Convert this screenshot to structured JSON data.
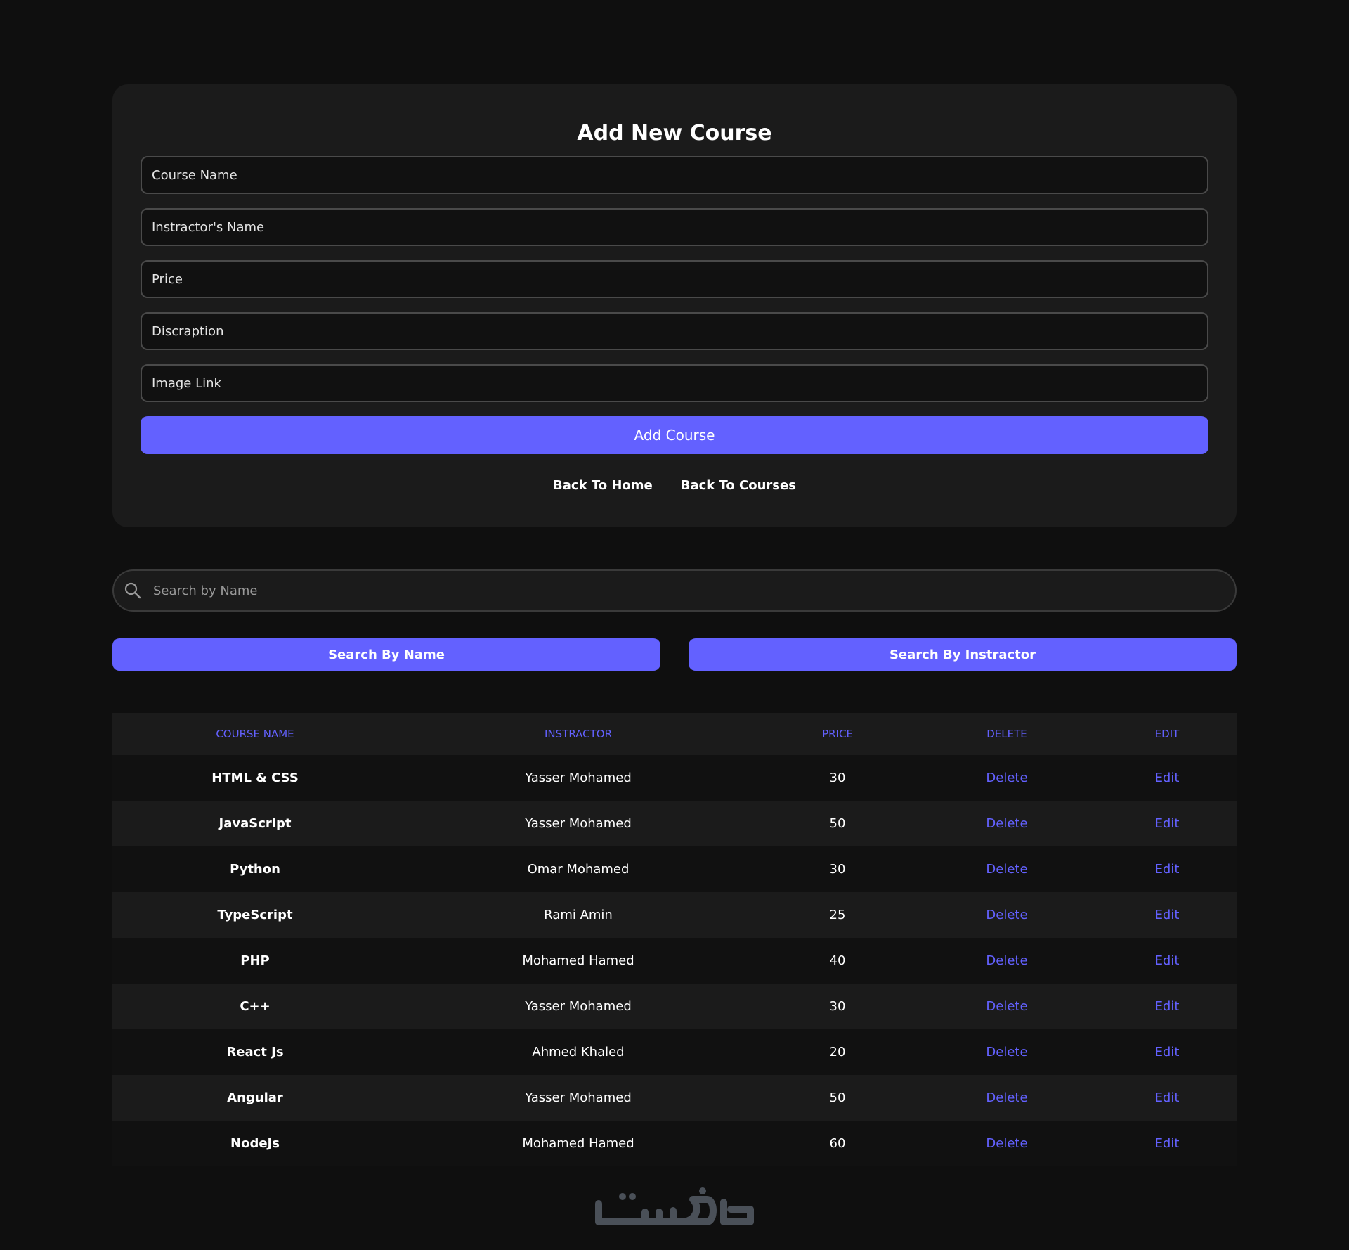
{
  "form": {
    "title": "Add New Course",
    "fields": [
      {
        "placeholder": "Course Name",
        "value": ""
      },
      {
        "placeholder": "Instractor's Name",
        "value": ""
      },
      {
        "placeholder": "Price",
        "value": ""
      },
      {
        "placeholder": "Discraption",
        "value": ""
      },
      {
        "placeholder": "Image Link",
        "value": ""
      }
    ],
    "submit_label": "Add Course",
    "links": [
      "Back To Home",
      "Back To Courses"
    ]
  },
  "search": {
    "placeholder": "Search by Name",
    "value": "",
    "by_name_label": "Search By Name",
    "by_instructor_label": "Search By Instractor"
  },
  "table": {
    "headers": [
      "Course Name",
      "Instractor",
      "Price",
      "Delete",
      "Edit"
    ],
    "rows": [
      {
        "name": "HTML & CSS",
        "instructor": "Yasser Mohamed",
        "price": "30",
        "delete": "Delete",
        "edit": "Edit"
      },
      {
        "name": "JavaScript",
        "instructor": "Yasser Mohamed",
        "price": "50",
        "delete": "Delete",
        "edit": "Edit"
      },
      {
        "name": "Python",
        "instructor": "Omar Mohamed",
        "price": "30",
        "delete": "Delete",
        "edit": "Edit"
      },
      {
        "name": "TypeScript",
        "instructor": "Rami Amin",
        "price": "25",
        "delete": "Delete",
        "edit": "Edit"
      },
      {
        "name": "PHP",
        "instructor": "Mohamed Hamed",
        "price": "40",
        "delete": "Delete",
        "edit": "Edit"
      },
      {
        "name": "C++",
        "instructor": "Yasser Mohamed",
        "price": "30",
        "delete": "Delete",
        "edit": "Edit"
      },
      {
        "name": "React Js",
        "instructor": "Ahmed Khaled",
        "price": "20",
        "delete": "Delete",
        "edit": "Edit"
      },
      {
        "name": "Angular",
        "instructor": "Yasser Mohamed",
        "price": "50",
        "delete": "Delete",
        "edit": "Edit"
      },
      {
        "name": "NodeJs",
        "instructor": "Mohamed Hamed",
        "price": "60",
        "delete": "Delete",
        "edit": "Edit"
      }
    ]
  },
  "footer": {
    "logo": "خمسات",
    "logo_icon": "khamsat-logo-icon"
  },
  "colors": {
    "background": "#0f0f0f",
    "card": "#1b1b1b",
    "accent": "#6361ff",
    "input_border": "#4a4a4a",
    "logo": "#4a5058"
  }
}
